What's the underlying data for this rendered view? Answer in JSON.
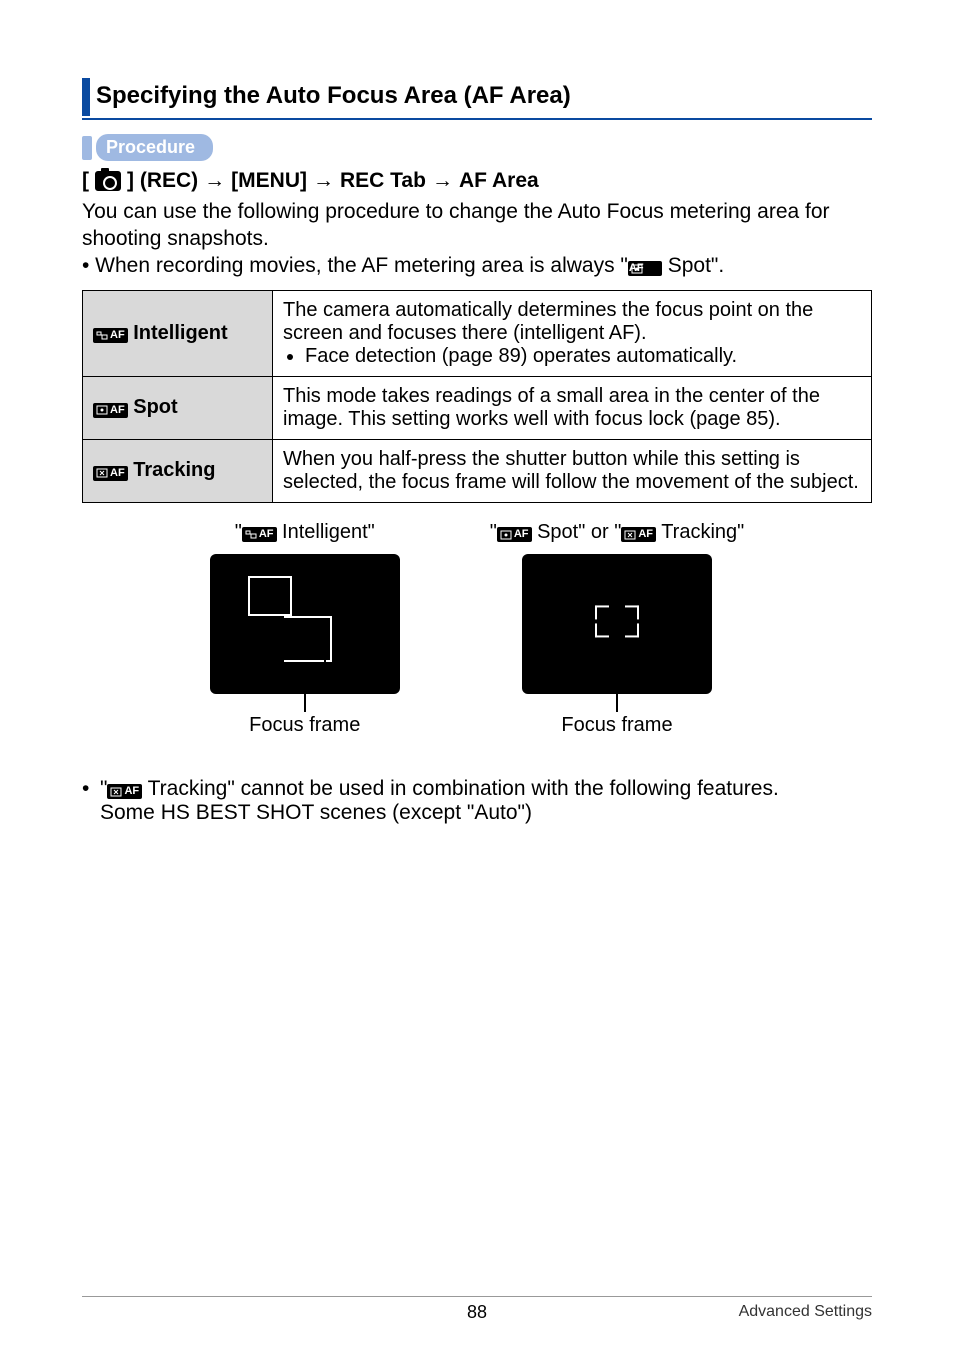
{
  "section_title": "Specifying the Auto Focus Area (AF Area)",
  "procedure_label": "Procedure",
  "breadcrumb": {
    "step1_prefix": "[",
    "step1_suffix": "] (REC)",
    "step2": "[MENU]",
    "step3": "REC Tab",
    "step4": "AF Area"
  },
  "intro": "You can use the following procedure to change the Auto Focus metering area for shooting snapshots.",
  "intro_bullet_pre": "• When recording movies, the AF metering area is always \"",
  "intro_bullet_mid": " Spot\".",
  "table": {
    "rows": [
      {
        "label": "Intelligent",
        "desc_line": "The camera automatically determines the focus point on the screen and focuses there (intelligent AF).",
        "desc_bullet": "Face detection (page 89) operates automatically."
      },
      {
        "label": "Spot",
        "desc_line": "This mode takes readings of a small area in the center of the image. This setting works well with focus lock (page 85)."
      },
      {
        "label": "Tracking",
        "desc_line": "When you half-press the shutter button while this setting is selected, the focus frame will follow the movement of the subject."
      }
    ]
  },
  "previews": {
    "left_label_pre": "\"",
    "left_label_post": " Intelligent\"",
    "right_label_pre": "\"",
    "right_label_mid1": " Spot\" or \"",
    "right_label_post": " Tracking\"",
    "caption": "Focus frame"
  },
  "note": {
    "line1_pre": "\"",
    "line1_post": " Tracking\" cannot be used in combination with the following features.",
    "line2": "Some HS BEST SHOT scenes (except \"Auto\")"
  },
  "footer": {
    "page_number": "88",
    "section_name": "Advanced Settings"
  }
}
